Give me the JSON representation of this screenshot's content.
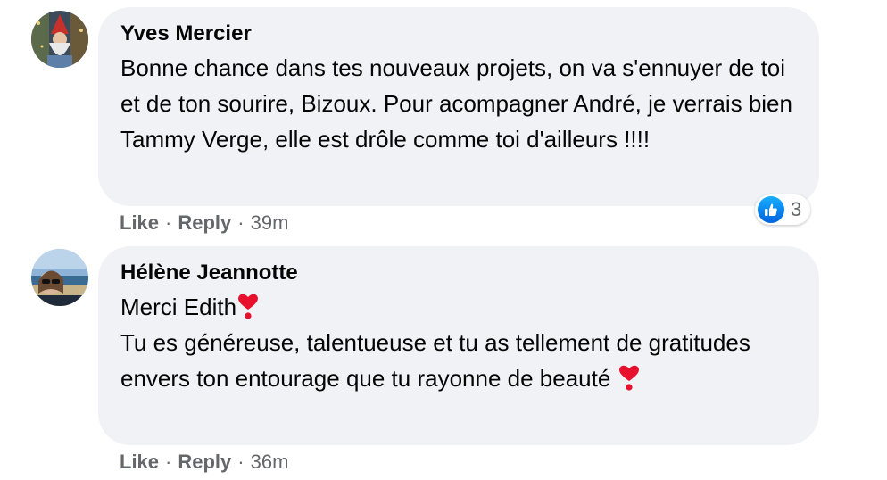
{
  "comments": [
    {
      "author": "Yves Mercier",
      "text": "Bonne chance dans tes nouveaux projets, on va s'ennuyer de toi et de ton sourire, Bizoux. Pour acompagner André, je verrais bien Tammy Verge, elle est drôle comme toi d'ailleurs !!!!",
      "like_label": "Like",
      "reply_label": "Reply",
      "time": "39m",
      "reaction_count": "3",
      "reaction_icon": "thumbs-up-icon"
    },
    {
      "author": "Hélène Jeannotte",
      "line1": "Merci Edith",
      "line2": "Tu es généreuse, talentueuse et tu as tellement de gratitudes envers ton entourage que tu rayonne de beauté",
      "emoji": "heavy-heart-exclamation-icon",
      "like_label": "Like",
      "reply_label": "Reply",
      "time": "36m"
    }
  ],
  "colors": {
    "bubble": "#f0f2f5",
    "meta_text": "#65676b",
    "like_blue": "#0062df",
    "heart_red": "#e8112d"
  }
}
